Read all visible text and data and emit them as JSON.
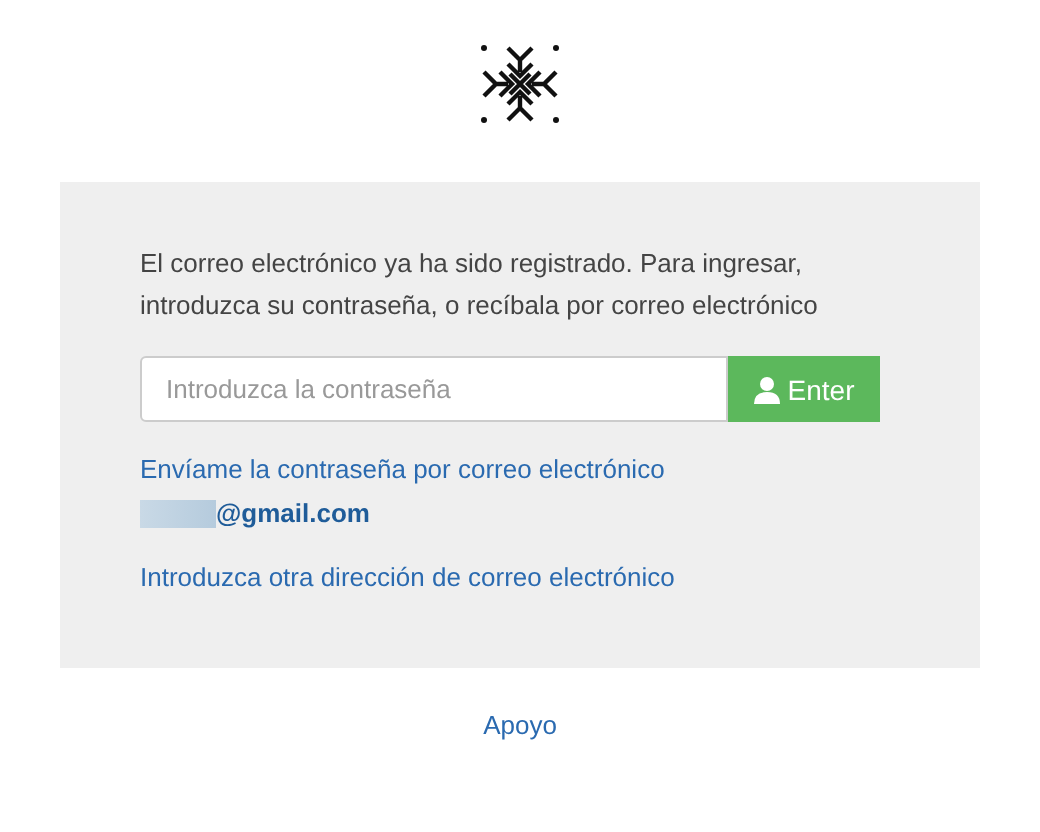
{
  "message": "El correo electrónico ya ha sido registrado. Para ingresar, introduzca su contraseña, o recíbala por correo electrónico",
  "password_field": {
    "placeholder": "Introduzca la contraseña"
  },
  "enter_button": {
    "label": "Enter"
  },
  "send_password_link": "Envíame la contraseña por correo electrónico",
  "email": "@gmail.com",
  "other_email_link": "Introduzca otra dirección de correo electrónico",
  "footer_link": "Apoyo"
}
